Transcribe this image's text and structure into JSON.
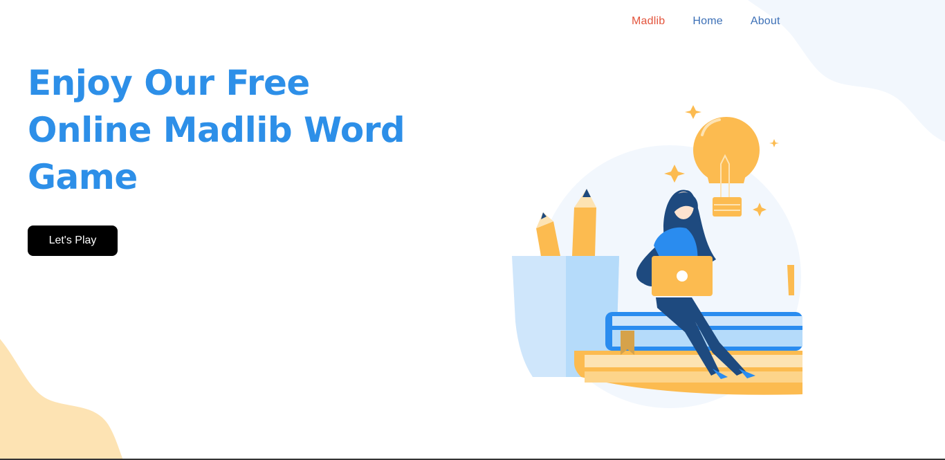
{
  "nav": {
    "items": [
      {
        "label": "Madlib",
        "active": true
      },
      {
        "label": "Home",
        "active": false
      },
      {
        "label": "About",
        "active": false
      }
    ]
  },
  "hero": {
    "headline": "Enjoy Our Free Online Madlib Word Game",
    "cta_label": "Let's Play"
  },
  "colors": {
    "headline": "#2d8fe8",
    "nav_active": "#e3543c",
    "nav_link": "#3b6fb6",
    "button_bg": "#000000",
    "accent_orange": "#fcbb50",
    "accent_blue": "#2a8cef"
  },
  "illustration": {
    "icon": "person-with-laptop-illustration"
  }
}
